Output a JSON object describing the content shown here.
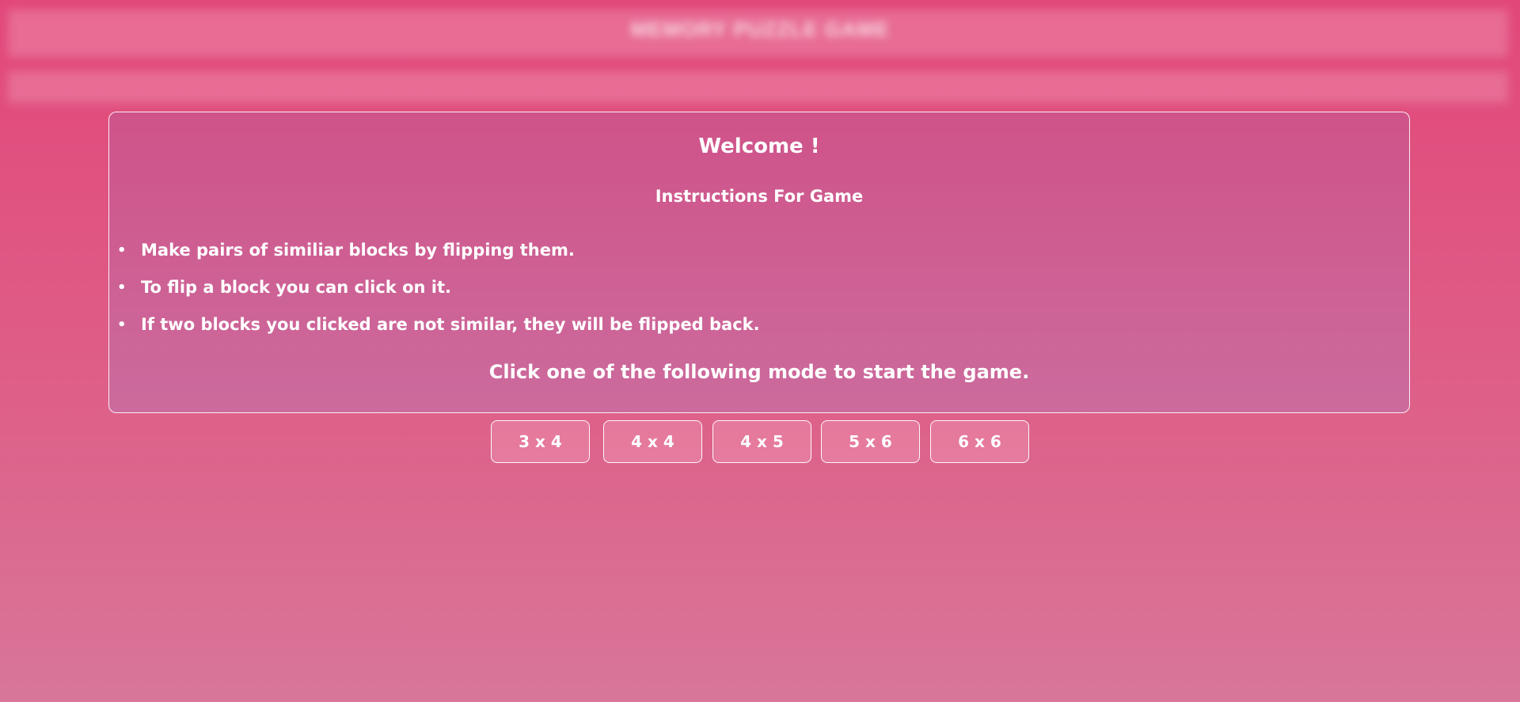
{
  "header": {
    "title": "MEMORY PUZZLE GAME"
  },
  "panel": {
    "welcome": "Welcome !",
    "instructions_heading": "Instructions For Game",
    "rules": [
      "Make pairs of similiar blocks by flipping them.",
      "To flip a block you can click on it.",
      "If two blocks you clicked are not similar, they will be flipped back."
    ],
    "start_prompt": "Click one of the following mode to start the game."
  },
  "modes": [
    {
      "label": "3 x 4"
    },
    {
      "label": "4 x 4"
    },
    {
      "label": "4 x 5"
    },
    {
      "label": "5 x 6"
    },
    {
      "label": "6 x 6"
    }
  ],
  "colors": {
    "background_top": "#e2477a",
    "background_bottom": "#d87699",
    "panel_top": "#cf5389",
    "panel_bottom": "#cc6b9d",
    "text": "#ffffff"
  }
}
